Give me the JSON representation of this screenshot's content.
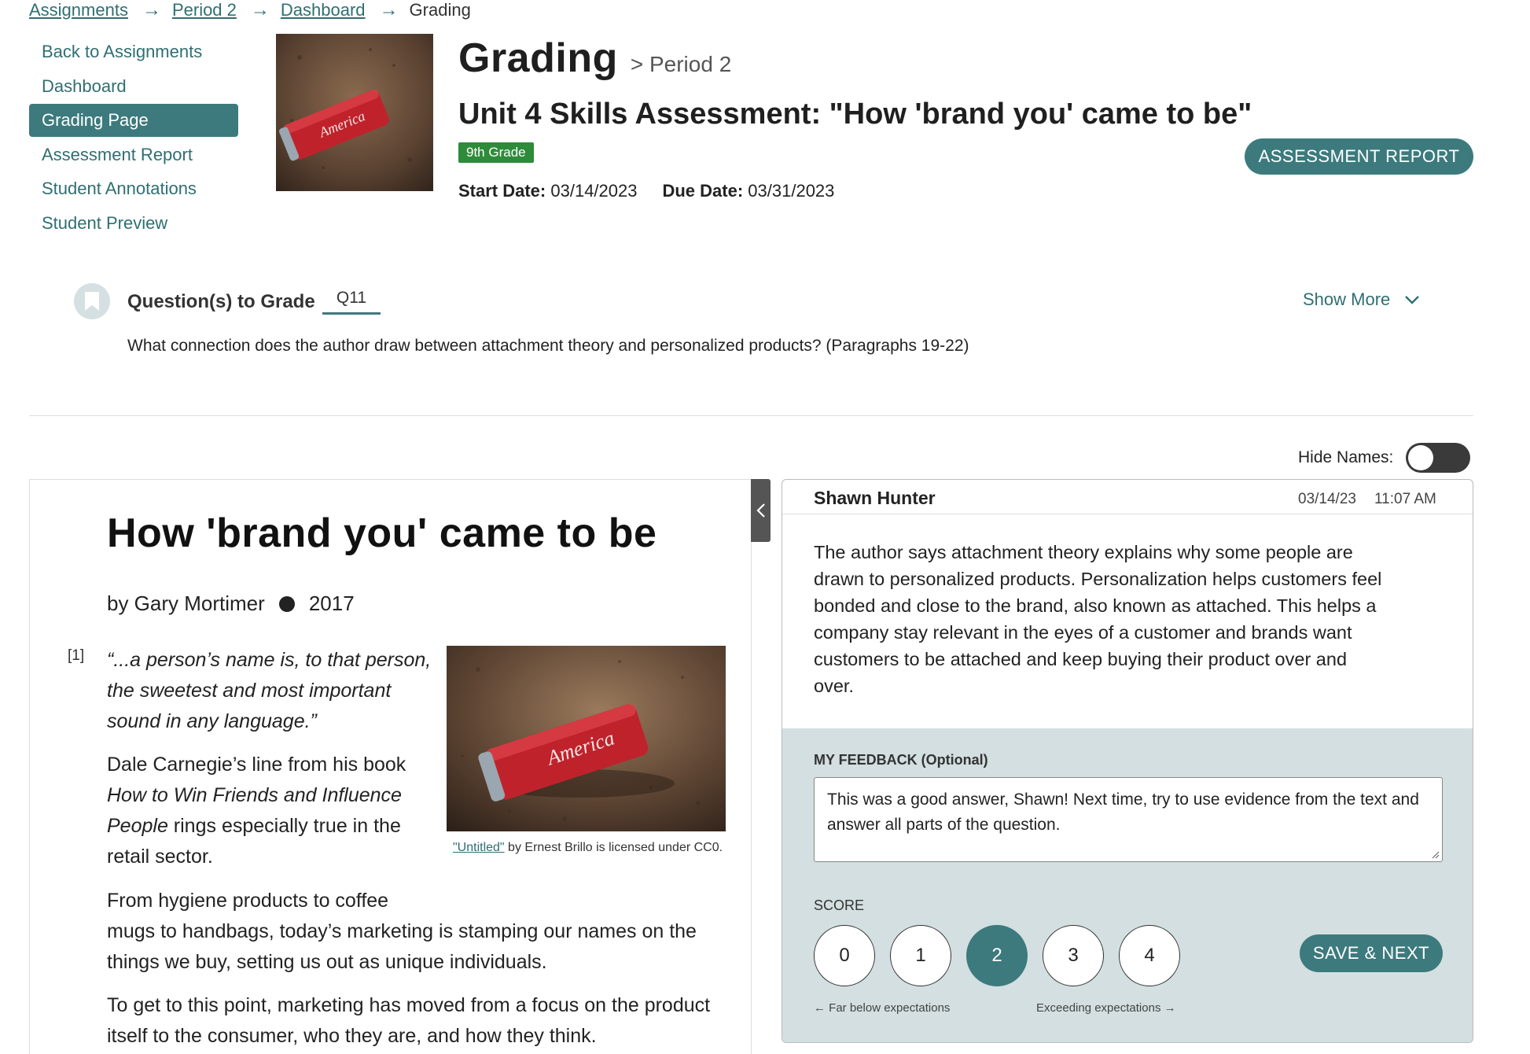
{
  "breadcrumb": {
    "items": [
      "Assignments",
      "Period 2",
      "Dashboard"
    ],
    "current": "Grading"
  },
  "nav": {
    "items": [
      {
        "label": "Back to Assignments"
      },
      {
        "label": "Dashboard"
      },
      {
        "label": "Grading Page",
        "active": true
      },
      {
        "label": "Assessment Report"
      },
      {
        "label": "Student Annotations"
      },
      {
        "label": "Student Preview"
      }
    ]
  },
  "header": {
    "title": "Grading",
    "subtitle": "> Period 2",
    "assignment_title": "Unit 4 Skills Assessment: \"How 'brand you' came to be\"",
    "grade_badge": "9th Grade",
    "start_label": "Start Date:",
    "start_date": "03/14/2023",
    "due_label": "Due Date:",
    "due_date": "03/31/2023",
    "report_button": "ASSESSMENT REPORT"
  },
  "question": {
    "label": "Question(s) to Grade",
    "tab": "Q11",
    "show_more": "Show More",
    "text": "What connection does the author draw between attachment theory and personalized products? (Paragraphs 19-22)"
  },
  "hide_names": {
    "label": "Hide Names:",
    "on": false
  },
  "article": {
    "title": "How 'brand you' came to be",
    "author": "by Gary Mortimer",
    "year": "2017",
    "para_num": "[1]",
    "quote": "“...a person’s name is, to that person, the sweetest and most important sound in any language.”",
    "body_a_1": "Dale Carnegie’s line from his book ",
    "body_a_ital": "How to Win Friends and Influence People",
    "body_a_2": " rings especially true in the retail sector.",
    "caption_link": "\"Untitled\"",
    "caption_rest": " by Ernest Brillo is licensed under CC0.",
    "body_b_1": "From hygiene products to coffee",
    "body_b_2": "mugs to handbags, today’s marketing is stamping our names on the things we buy, setting us out as unique individuals.",
    "body_c": "To get to this point, marketing has moved from a focus on the product itself to the consumer, who they are, and how they think.",
    "can_text": "America"
  },
  "response": {
    "student_name": "Shawn Hunter",
    "date": "03/14/23",
    "time": "11:07 AM",
    "text": "The author says attachment theory explains why some people are drawn to personalized products. Personalization helps customers feel bonded and close to the brand, also known as attached. This helps a company stay relevant in the eyes of a customer and brands want customers to be attached and keep buying their product over and over."
  },
  "feedback": {
    "label": "MY FEEDBACK (Optional)",
    "value": "This was a good answer, Shawn! Next time, try to use evidence from the text and answer all parts of the question."
  },
  "score": {
    "label": "SCORE",
    "options": [
      "0",
      "1",
      "2",
      "3",
      "4"
    ],
    "selected": "2",
    "low_label": "Far below expectations",
    "high_label": "Exceeding expectations",
    "save_button": "SAVE & NEXT"
  },
  "colors": {
    "accent": "#3c7a7d",
    "link": "#2f6f72",
    "badge": "#2e8b3a",
    "feedback_bg": "#d3dfe1"
  }
}
